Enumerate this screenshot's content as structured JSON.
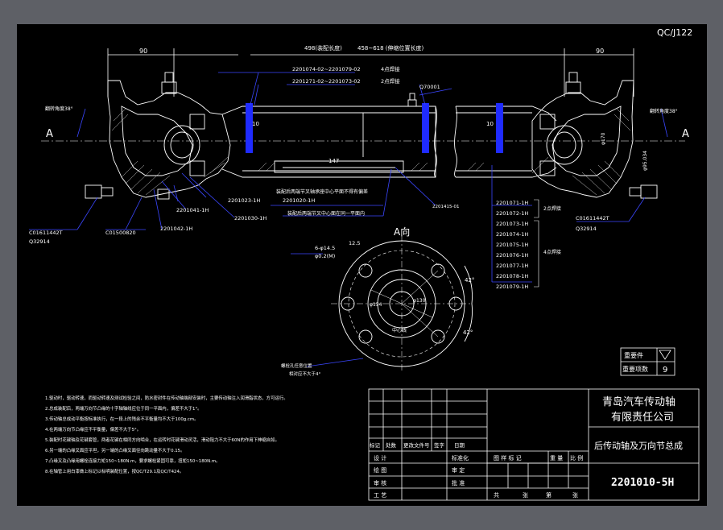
{
  "drawing": {
    "code": "QC/J122",
    "dims": {
      "left_90": "90",
      "right_90": "90",
      "length_498": "498(装配长度)",
      "length_range": "458~618 (伸缩位置长度)",
      "len_147": "147",
      "d_10_left": "10",
      "d_10_right": "10",
      "phi_170": "φ170",
      "phi_95": "φ95.034",
      "phi_154": "φ154",
      "phi_130": "φ130",
      "angle_42a": "42°",
      "angle_42b": "42°",
      "hole_spec": "6-φ14.5",
      "hole_spec_sub": "φ0.2(M)",
      "dim_12_5": "12.5",
      "wheel_left": "翻转角度38°",
      "wheel_right": "翻转角度38°"
    },
    "section_marks": {
      "a_left": "A",
      "a_right": "A"
    },
    "view_title": "A向",
    "center_label": "中心线",
    "labels": {
      "l1": "2201074-02~2201079-02",
      "l1_note": "4点焊接",
      "l2": "2201271-02~2201073-02",
      "l2_note": "2点焊接",
      "grease": "Q70001",
      "p_2201023": "2201023-1H",
      "p_2201020": "2201020-1H",
      "p_2201041": "2201041-1H",
      "p_2201030": "2201030-1H",
      "p_2201042": "2201042-1H",
      "p_c0150": "C01500820",
      "p_c0161_left": "C01611442T",
      "p_q32914_left": "Q32914",
      "p_c0161_right": "C01611442T",
      "p_q32914_right": "Q32914",
      "p_2201415": "2201415-01",
      "note_a": "装配后两端节叉轴承座中心平面不得有偏差",
      "note_b": "装配后两端节叉中心面在同一平面内",
      "flange_note1": "螺栓孔任意位置",
      "flange_note2": "相对应不大于4°",
      "right_list": [
        "2201071-1H",
        "2201072-1H",
        "2201073-1H",
        "2201074-1H",
        "2201075-1H",
        "2201076-1H",
        "2201077-1H",
        "2201078-1H",
        "2201079-1H"
      ],
      "right_note1": "2点焊接",
      "right_note2": "4点焊接"
    },
    "notes": [
      "1.驱动时，驱动转速，而驱动转速及测试检验之间，防水密封件在传动轴端部安装时，主要传动轴注入润滑脂状态，方可运行。",
      "2.总成装配后，两端万向节凸缘的十字轴轴线应位于同一平面内，偏差不大于1°。",
      "3.传动轴总成动平衡按标准执行，在一段上的残余不平衡量均不大于100g.cm。",
      "4.在两端万向节凸缘应不平衡量，偏差不大于5°。",
      "5.装配时花键轴及花键套管，两者花键在相同方向啮合，在运转时花键滑动灵活，滑动阻力不大于60N的作用下伸缩自如。",
      "6.另一端的凸缘叉面应平坦，另一端的凸缘叉面径向跳动量不大于0.15。",
      "7.凸缘叉及凸缘用螺栓连接力矩150~180N.m，要求螺栓紧固可靠，扭矩150~180N.m。",
      "8.在轴管上用白漆做上标记以标明装配位置，按QC/T29.1及QC/T424。"
    ],
    "weight_table": {
      "row1_label": "重要件",
      "row2_label": "重要项数",
      "row2_value": "9"
    },
    "title_block": {
      "company_line1": "青岛汽车传动轴",
      "company_line2": "有限责任公司",
      "drawing_name": "后传动轴及万向节总成",
      "drawing_number": "2201010-5H",
      "rev_headers": [
        "标记",
        "处数",
        "更改文件号",
        "签字",
        "日期"
      ],
      "sign_rows": [
        {
          "role": "设 计",
          "mid": "标准化"
        },
        {
          "role": "绘 图",
          "mid": "审 定"
        },
        {
          "role": "审 核",
          "mid": "批 准"
        },
        {
          "role": "工 艺",
          "mid": ""
        }
      ],
      "stage_label": "图 样 标 记",
      "weight_label": "重 量",
      "scale_label": "比 例",
      "sheets_total": "共",
      "sheets_unit": "张",
      "sheets_no": "第",
      "sheets_unit2": "张"
    }
  }
}
